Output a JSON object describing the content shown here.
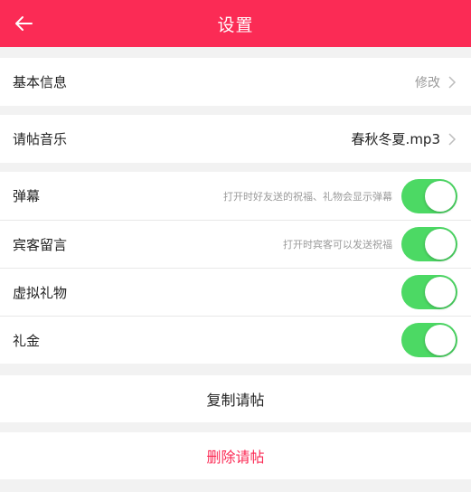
{
  "header": {
    "title": "设置",
    "bg_color": "#fb2b55",
    "back_icon": "arrow-left-icon"
  },
  "basic_info": {
    "label": "基本信息",
    "action": "修改"
  },
  "music": {
    "label": "请帖音乐",
    "value": "春秋冬夏.mp3"
  },
  "toggles": [
    {
      "label": "弹幕",
      "hint": "打开时好友送的祝福、礼物会显示弹幕",
      "on": true
    },
    {
      "label": "宾客留言",
      "hint": "打开时宾客可以发送祝福",
      "on": true
    },
    {
      "label": "虚拟礼物",
      "hint": "",
      "on": true
    },
    {
      "label": "礼金",
      "hint": "",
      "on": true
    }
  ],
  "actions": {
    "copy": "复制请帖",
    "delete": "删除请帖",
    "delete_color": "#fb2b55"
  },
  "colors": {
    "toggle_on": "#4cd964",
    "background": "#f2f2f2"
  }
}
